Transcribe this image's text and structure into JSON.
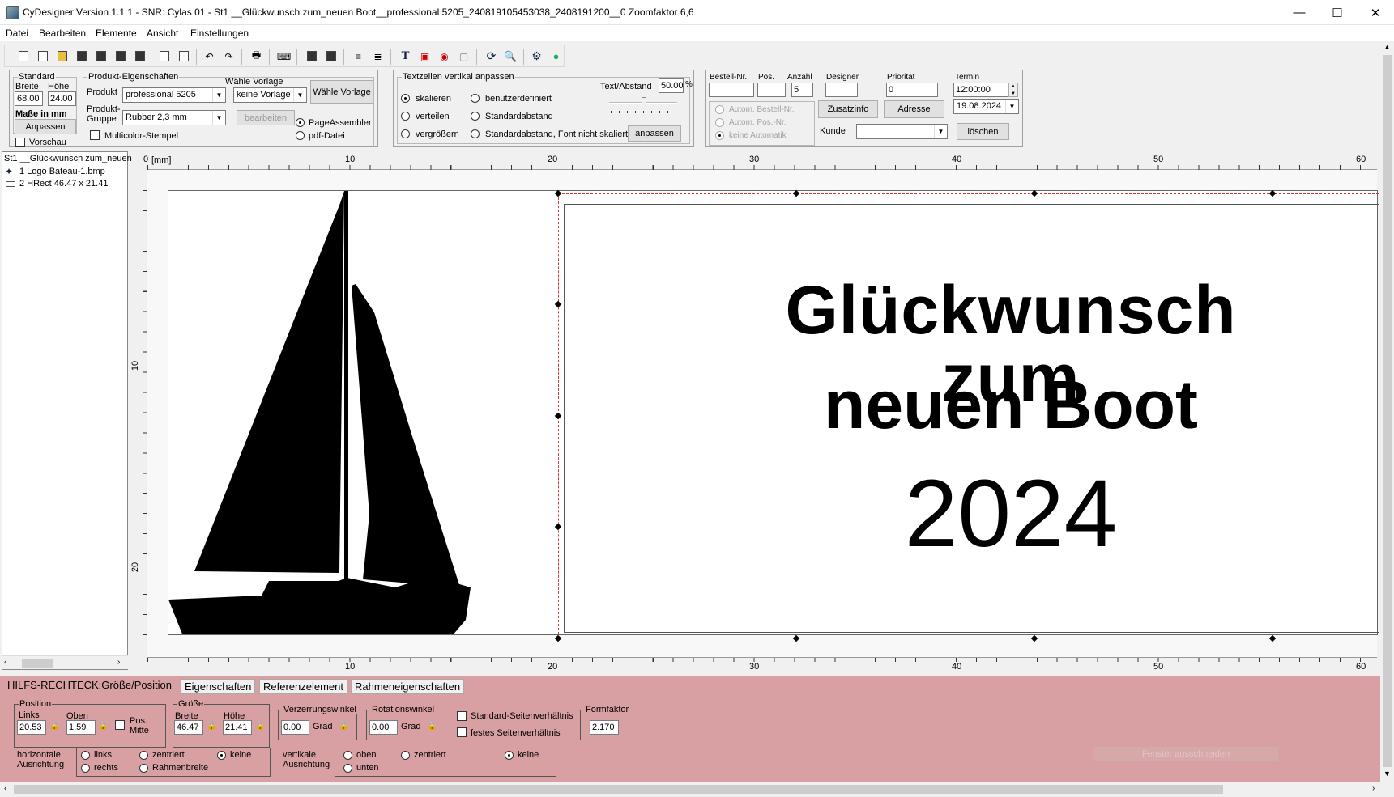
{
  "window": {
    "title": "CyDesigner Version 1.1.1 - SNR: Cylas 01 -  St1 __Glückwunsch zum_neuen Boot__professional 5205_240819105453038_2408191200__0 Zoomfaktor 6,6",
    "minimize": "—",
    "maximize": "☐",
    "close": "✕"
  },
  "menu": [
    "Datei",
    "Bearbeiten",
    "Elemente",
    "Ansicht",
    "Einstellungen"
  ],
  "standard": {
    "group": "Standard",
    "breite_label": "Breite",
    "hoehe_label": "Höhe",
    "breite": "68.00",
    "hoehe": "24.00",
    "masse": "Maße in mm",
    "anpassen": "Anpassen",
    "vorschau": "Vorschau"
  },
  "produkt": {
    "group": "Produkt-Eigenschaften",
    "produkt_label": "Produkt",
    "produkt_value": "professional 5205",
    "vorlage_label": "Wähle Vorlage",
    "vorlage_value": "keine Vorlage",
    "vorlage_button": "Wähle Vorlage",
    "gruppe_label1": "Produkt-",
    "gruppe_label2": "Gruppe",
    "gruppe_value": "Rubber 2,3 mm",
    "bearbeiten": "bearbeiten",
    "multicolor": "Multicolor-Stempel",
    "pageassembler": "PageAssembler",
    "pdf": "pdf-Datei"
  },
  "textzeilen": {
    "group": "Textzeilen vertikal anpassen",
    "skalieren": "skalieren",
    "verteilen": "verteilen",
    "vergroessern": "vergrößern",
    "benutzer": "benutzerdefiniert",
    "standardabstand": "Standardabstand",
    "standardabstand_font": "Standardabstand, Font nicht skaliert",
    "abstand_label": "Text/Abstand",
    "abstand_value": "50.00",
    "percent": "%",
    "anpassen": "anpassen"
  },
  "order": {
    "bestell_label": "Bestell-Nr.",
    "pos_label": "Pos.",
    "anzahl_label": "Anzahl",
    "anzahl_value": "5",
    "designer_label": "Designer",
    "prioritaet_label": "Priorität",
    "prioritaet_value": "0",
    "termin_label": "Termin",
    "termin_time": "12:00:00",
    "termin_date": "19.08.2024",
    "auto_bestell": "Autom. Bestell-Nr.",
    "auto_pos": "Autom. Pos.-Nr.",
    "keine_auto": "keine Automatik",
    "zusatzinfo": "Zusatzinfo",
    "adresse": "Adresse",
    "kunde_label": "Kunde",
    "loeschen": "löschen"
  },
  "tree": {
    "root": "St1 __Glückwunsch zum_neuen",
    "items": [
      "1 Logo Bateau-1.bmp",
      "2 HRect 46.47 x 21.41"
    ]
  },
  "ruler": {
    "unit": "[mm]",
    "top_labels": [
      "0",
      "10",
      "20",
      "30",
      "40",
      "50",
      "60"
    ],
    "bottom_labels": [
      "10",
      "20",
      "30",
      "40",
      "50",
      "60"
    ],
    "left_labels": [
      "10",
      "20"
    ]
  },
  "stamp": {
    "line1": "Glückwunsch zum",
    "line2": "neuen Boot",
    "line3": "2024"
  },
  "tabs": [
    "HILFS-RECHTECK:Größe/Position",
    "Eigenschaften",
    "Referenzelement",
    "Rahmeneigenschaften"
  ],
  "props": {
    "position_group": "Position",
    "links_label": "Links",
    "oben_label": "Oben",
    "links_value": "20.53",
    "oben_value": "1.59",
    "pos_mitte1": "Pos.",
    "pos_mitte2": "Mitte",
    "groesse_group": "Größe",
    "breite_label": "Breite",
    "hoehe_label": "Höhe",
    "breite_value": "46.47",
    "hoehe_value": "21.41",
    "verzerrung_group": "Verzerrungswinkel",
    "verzerrung_value": "0.00",
    "grad": "Grad",
    "rotation_group": "Rotationswinkel",
    "rotation_value": "0.00",
    "std_seiten": "Standard-Seitenverhältnis",
    "festes_seiten": "festes Seitenverhältnis",
    "formfaktor_group": "Formfaktor",
    "formfaktor_value": "2.170",
    "h_ausr1": "horizontale",
    "h_ausr2": "Ausrichtung",
    "links": "links",
    "rechts": "rechts",
    "zentriert": "zentriert",
    "rahmenbreite": "Rahmenbreite",
    "keine": "keine",
    "v_ausr1": "vertikale",
    "v_ausr2": "Ausrichtung",
    "oben": "oben",
    "unten": "unten",
    "v_zentriert": "zentriert",
    "v_keine": "keine",
    "fenster": "Fenster ausschneiden"
  },
  "colors": {
    "panel_pink": "#d8a0a2",
    "guide_red": "#e03030"
  }
}
